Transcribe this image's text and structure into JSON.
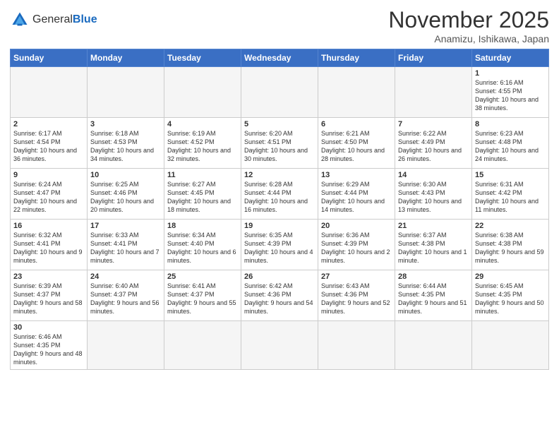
{
  "logo": {
    "general": "General",
    "blue": "Blue"
  },
  "header": {
    "month": "November 2025",
    "location": "Anamizu, Ishikawa, Japan"
  },
  "weekdays": [
    "Sunday",
    "Monday",
    "Tuesday",
    "Wednesday",
    "Thursday",
    "Friday",
    "Saturday"
  ],
  "weeks": [
    [
      {
        "day": "",
        "text": ""
      },
      {
        "day": "",
        "text": ""
      },
      {
        "day": "",
        "text": ""
      },
      {
        "day": "",
        "text": ""
      },
      {
        "day": "",
        "text": ""
      },
      {
        "day": "",
        "text": ""
      },
      {
        "day": "1",
        "text": "Sunrise: 6:16 AM\nSunset: 4:55 PM\nDaylight: 10 hours and 38 minutes."
      }
    ],
    [
      {
        "day": "2",
        "text": "Sunrise: 6:17 AM\nSunset: 4:54 PM\nDaylight: 10 hours and 36 minutes."
      },
      {
        "day": "3",
        "text": "Sunrise: 6:18 AM\nSunset: 4:53 PM\nDaylight: 10 hours and 34 minutes."
      },
      {
        "day": "4",
        "text": "Sunrise: 6:19 AM\nSunset: 4:52 PM\nDaylight: 10 hours and 32 minutes."
      },
      {
        "day": "5",
        "text": "Sunrise: 6:20 AM\nSunset: 4:51 PM\nDaylight: 10 hours and 30 minutes."
      },
      {
        "day": "6",
        "text": "Sunrise: 6:21 AM\nSunset: 4:50 PM\nDaylight: 10 hours and 28 minutes."
      },
      {
        "day": "7",
        "text": "Sunrise: 6:22 AM\nSunset: 4:49 PM\nDaylight: 10 hours and 26 minutes."
      },
      {
        "day": "8",
        "text": "Sunrise: 6:23 AM\nSunset: 4:48 PM\nDaylight: 10 hours and 24 minutes."
      }
    ],
    [
      {
        "day": "9",
        "text": "Sunrise: 6:24 AM\nSunset: 4:47 PM\nDaylight: 10 hours and 22 minutes."
      },
      {
        "day": "10",
        "text": "Sunrise: 6:25 AM\nSunset: 4:46 PM\nDaylight: 10 hours and 20 minutes."
      },
      {
        "day": "11",
        "text": "Sunrise: 6:27 AM\nSunset: 4:45 PM\nDaylight: 10 hours and 18 minutes."
      },
      {
        "day": "12",
        "text": "Sunrise: 6:28 AM\nSunset: 4:44 PM\nDaylight: 10 hours and 16 minutes."
      },
      {
        "day": "13",
        "text": "Sunrise: 6:29 AM\nSunset: 4:44 PM\nDaylight: 10 hours and 14 minutes."
      },
      {
        "day": "14",
        "text": "Sunrise: 6:30 AM\nSunset: 4:43 PM\nDaylight: 10 hours and 13 minutes."
      },
      {
        "day": "15",
        "text": "Sunrise: 6:31 AM\nSunset: 4:42 PM\nDaylight: 10 hours and 11 minutes."
      }
    ],
    [
      {
        "day": "16",
        "text": "Sunrise: 6:32 AM\nSunset: 4:41 PM\nDaylight: 10 hours and 9 minutes."
      },
      {
        "day": "17",
        "text": "Sunrise: 6:33 AM\nSunset: 4:41 PM\nDaylight: 10 hours and 7 minutes."
      },
      {
        "day": "18",
        "text": "Sunrise: 6:34 AM\nSunset: 4:40 PM\nDaylight: 10 hours and 6 minutes."
      },
      {
        "day": "19",
        "text": "Sunrise: 6:35 AM\nSunset: 4:39 PM\nDaylight: 10 hours and 4 minutes."
      },
      {
        "day": "20",
        "text": "Sunrise: 6:36 AM\nSunset: 4:39 PM\nDaylight: 10 hours and 2 minutes."
      },
      {
        "day": "21",
        "text": "Sunrise: 6:37 AM\nSunset: 4:38 PM\nDaylight: 10 hours and 1 minute."
      },
      {
        "day": "22",
        "text": "Sunrise: 6:38 AM\nSunset: 4:38 PM\nDaylight: 9 hours and 59 minutes."
      }
    ],
    [
      {
        "day": "23",
        "text": "Sunrise: 6:39 AM\nSunset: 4:37 PM\nDaylight: 9 hours and 58 minutes."
      },
      {
        "day": "24",
        "text": "Sunrise: 6:40 AM\nSunset: 4:37 PM\nDaylight: 9 hours and 56 minutes."
      },
      {
        "day": "25",
        "text": "Sunrise: 6:41 AM\nSunset: 4:37 PM\nDaylight: 9 hours and 55 minutes."
      },
      {
        "day": "26",
        "text": "Sunrise: 6:42 AM\nSunset: 4:36 PM\nDaylight: 9 hours and 54 minutes."
      },
      {
        "day": "27",
        "text": "Sunrise: 6:43 AM\nSunset: 4:36 PM\nDaylight: 9 hours and 52 minutes."
      },
      {
        "day": "28",
        "text": "Sunrise: 6:44 AM\nSunset: 4:35 PM\nDaylight: 9 hours and 51 minutes."
      },
      {
        "day": "29",
        "text": "Sunrise: 6:45 AM\nSunset: 4:35 PM\nDaylight: 9 hours and 50 minutes."
      }
    ],
    [
      {
        "day": "30",
        "text": "Sunrise: 6:46 AM\nSunset: 4:35 PM\nDaylight: 9 hours and 48 minutes."
      },
      {
        "day": "",
        "text": ""
      },
      {
        "day": "",
        "text": ""
      },
      {
        "day": "",
        "text": ""
      },
      {
        "day": "",
        "text": ""
      },
      {
        "day": "",
        "text": ""
      },
      {
        "day": "",
        "text": ""
      }
    ]
  ]
}
